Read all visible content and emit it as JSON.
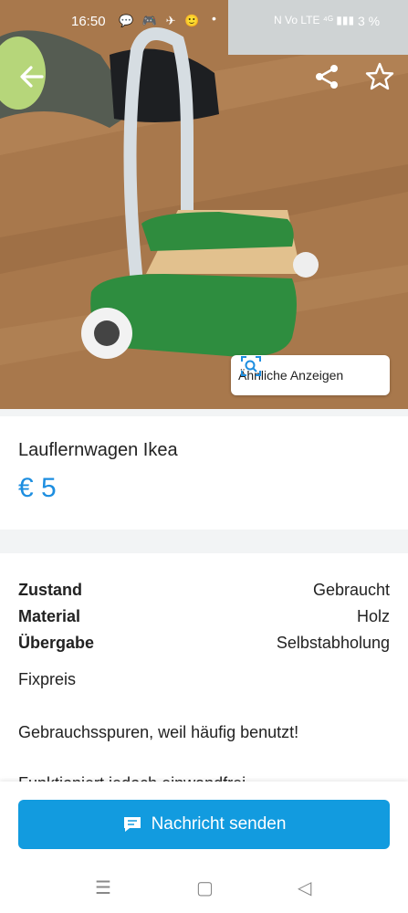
{
  "status_bar": {
    "time": "16:50",
    "notifications": "💬 🎮 ✈ 🙂",
    "dot": "•",
    "system": "N  Vo LTE  ⁴ᴳ  ▮▮▮",
    "battery": "3 %"
  },
  "photo": {
    "similar_label": "Ähnliche Anzeigen",
    "back_icon": "arrow-left-icon",
    "share_icon": "share-icon",
    "star_icon": "star-outline-icon"
  },
  "listing": {
    "title": "Lauflernwagen Ikea",
    "price": "€ 5"
  },
  "details": {
    "rows": [
      {
        "key": "Zustand",
        "value": "Gebraucht"
      },
      {
        "key": "Material",
        "value": "Holz"
      },
      {
        "key": "Übergabe",
        "value": "Selbstabholung"
      }
    ],
    "price_type": "Fixpreis",
    "description_line1": "Gebrauchsspuren, weil häufig benutzt!",
    "description_line2": "Funktioniert jedoch einwandfrei"
  },
  "actions": {
    "send_message": "Nachricht senden"
  },
  "nav": {
    "menu": "☰",
    "home": "▢",
    "back": "◁"
  },
  "colors": {
    "accent": "#129bdf",
    "price": "#1d8ee0"
  }
}
